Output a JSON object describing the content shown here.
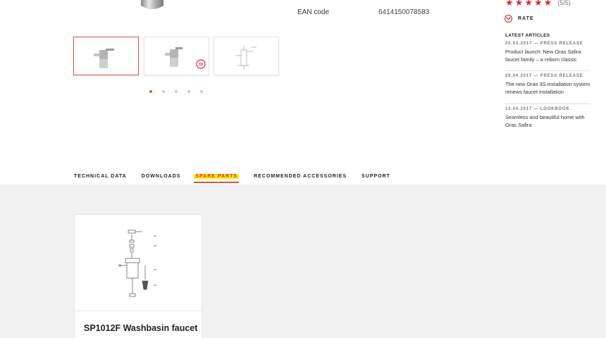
{
  "product": {
    "ean_label": "EAN code",
    "ean_value": "6414150078583"
  },
  "gallery": {
    "thumbnails": [
      {
        "name": "faucet-front",
        "active": true
      },
      {
        "name": "faucet-3d",
        "badge": "3D",
        "active": false
      },
      {
        "name": "faucet-drawing",
        "active": false
      }
    ],
    "dots": 5,
    "active_dot": 0
  },
  "sidebar": {
    "stars": 5,
    "rating_text": "(5/5)",
    "rate_label": "RATE",
    "latest_title": "LATEST ARTICLES",
    "articles": [
      {
        "meta": "20.03.2017 — PRESS RELEASE",
        "text": "Product launch: New Oras Safira faucet family – a reborn classic"
      },
      {
        "meta": "26.04.2017 — PRESS RELEASE",
        "text": "The new Oras 3S-installation system renews faucet installation"
      },
      {
        "meta": "13.04.2017 — LOOKBOOK",
        "text": "Seamless and beautiful home with Oras Safira"
      }
    ]
  },
  "tabs": [
    {
      "label": "TECHNICAL DATA",
      "active": false
    },
    {
      "label": "DOWNLOADS",
      "active": false
    },
    {
      "label": "SPARE PARTS",
      "active": true
    },
    {
      "label": "RECOMMENDED ACCESSORIES",
      "active": false
    },
    {
      "label": "SUPPORT",
      "active": false
    }
  ],
  "spare_parts": {
    "cards": [
      {
        "title": "SP1012F Washbasin faucet"
      }
    ]
  },
  "colors": {
    "accent": "#e0503c",
    "star": "#e0283a",
    "highlight": "#fff200",
    "grey_bg": "#f2f2f2"
  }
}
